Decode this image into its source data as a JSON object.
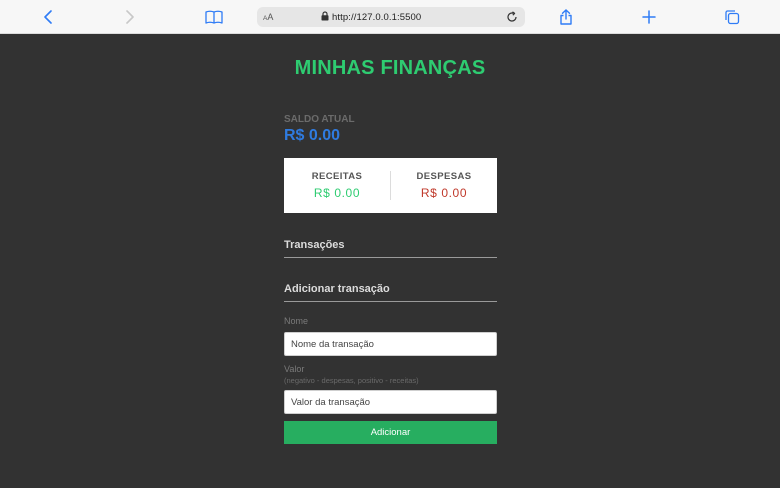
{
  "browser": {
    "url": "http://127.0.0.1:5500",
    "text_size_label_small": "A",
    "text_size_label_large": "A",
    "icons": {
      "back": "chevron-left-icon",
      "forward": "chevron-right-icon",
      "bookmarks": "book-icon",
      "lock": "lock-icon",
      "reload": "reload-icon",
      "share": "share-icon",
      "new_tab": "plus-icon",
      "tabs": "tabs-icon"
    },
    "colors": {
      "accent": "#2f7cf6"
    }
  },
  "app": {
    "title": "MINHAS FINANÇAS",
    "colors": {
      "title": "#2ecc71",
      "balance": "#2f7be0",
      "income": "#2ecc71",
      "expense": "#c0392b",
      "button": "#27ae60",
      "background": "#323232"
    }
  },
  "balance": {
    "label": "SALDO ATUAL",
    "value": "R$ 0.00"
  },
  "summary": {
    "income_label": "RECEITAS",
    "income_value": "R$ 0.00",
    "expense_label": "DESPESAS",
    "expense_value": "R$ 0.00"
  },
  "transactions": {
    "title": "Transações"
  },
  "form": {
    "title": "Adicionar transação",
    "name_label": "Nome",
    "name_placeholder": "Nome da transação",
    "value_label": "Valor",
    "value_hint": "(negativo - despesas, positivo - receitas)",
    "value_placeholder": "Valor da transação",
    "submit_label": "Adicionar"
  }
}
